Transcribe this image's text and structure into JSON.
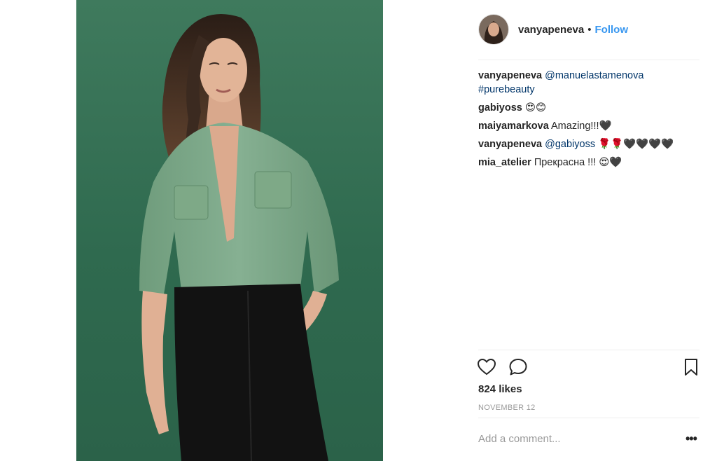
{
  "post": {
    "username": "vanyapeneva",
    "separator": "•",
    "follow_label": "Follow"
  },
  "comments": [
    {
      "user": "vanyapeneva",
      "parts": [
        {
          "kind": "link",
          "text": "@manuelastamenova"
        },
        {
          "kind": "text",
          "text": " "
        },
        {
          "kind": "link",
          "text": "#purebeauty"
        }
      ]
    },
    {
      "user": "gabiyoss",
      "parts": [
        {
          "kind": "text",
          "text": "😍😊"
        }
      ]
    },
    {
      "user": "maiyamarkova",
      "parts": [
        {
          "kind": "text",
          "text": "Amazing!!!🖤"
        }
      ]
    },
    {
      "user": "vanyapeneva",
      "parts": [
        {
          "kind": "link",
          "text": "@gabiyoss"
        },
        {
          "kind": "text",
          "text": " 🌹🌹🖤🖤🖤🖤"
        }
      ]
    },
    {
      "user": "mia_atelier",
      "parts": [
        {
          "kind": "text",
          "text": "Прекрасна !!! 😍🖤"
        }
      ]
    }
  ],
  "icons": {
    "like": "heart-icon",
    "comment": "speech-bubble-icon",
    "save": "bookmark-icon",
    "more": "more-options-icon"
  },
  "stats": {
    "likes": "824 likes",
    "date": "NOVEMBER 12"
  },
  "composer": {
    "placeholder": "Add a comment...",
    "more_label": "•••"
  },
  "colors": {
    "accent": "#3897f0",
    "link": "#003569",
    "muted": "#999999",
    "photo_background": "#2f6a4f",
    "shirt": "#7aa585"
  }
}
